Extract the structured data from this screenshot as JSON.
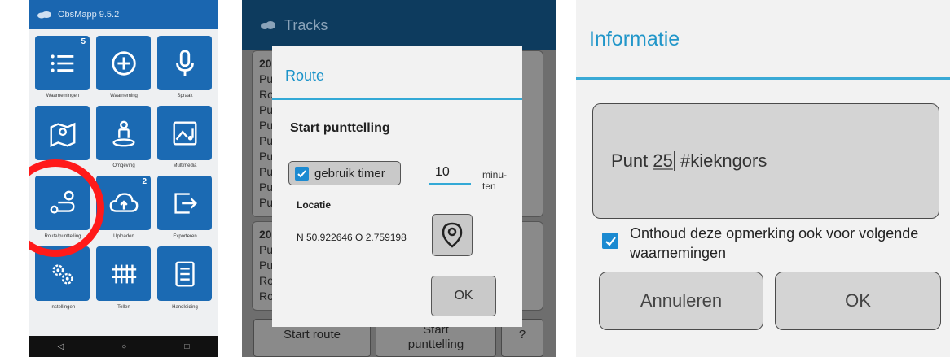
{
  "panel_home": {
    "app_title": "ObsMapp 9.5.2",
    "tiles": [
      {
        "label": "Waarnemingen",
        "icon": "list-icon",
        "badge": "5"
      },
      {
        "label": "Waarneming",
        "icon": "plus-circle-icon",
        "badge": ""
      },
      {
        "label": "Spraak",
        "icon": "microphone-icon",
        "badge": ""
      },
      {
        "label": "Kaart",
        "icon": "map-icon",
        "badge": ""
      },
      {
        "label": "Omgeving",
        "icon": "person-location-icon",
        "badge": ""
      },
      {
        "label": "Multimedia",
        "icon": "multimedia-icon",
        "badge": ""
      },
      {
        "label": "Route/punttelling",
        "icon": "route-icon",
        "badge": ""
      },
      {
        "label": "Uploaden",
        "icon": "cloud-upload-icon",
        "badge": "2"
      },
      {
        "label": "Exporteren",
        "icon": "export-icon",
        "badge": ""
      },
      {
        "label": "Instellingen",
        "icon": "gears-icon",
        "badge": ""
      },
      {
        "label": "Tellen",
        "icon": "tally-icon",
        "badge": ""
      },
      {
        "label": "Handleiding",
        "icon": "manual-icon",
        "badge": ""
      }
    ],
    "nav": {
      "back": "◁",
      "home": "○",
      "recents": "□"
    },
    "highlight_color": "#ff1a1a"
  },
  "panel_route": {
    "app_title": "Tracks",
    "card_prefix_1": "20",
    "card_lines_1": [
      "Pu",
      "Ro",
      "Pu",
      "Pu",
      "Pu",
      "Pu",
      "Pu",
      "Pu",
      "Pu",
      "Pu"
    ],
    "card_prefix_2": "20",
    "card_lines_2": [
      "Pu",
      "Pu",
      "Ro",
      "Ro"
    ],
    "bottom_buttons": {
      "start_route": "Start route",
      "start_count_line1": "Start",
      "start_count_line2": "punttelling",
      "help": "?"
    },
    "dialog": {
      "title": "Route",
      "subtitle": "Start punttelling",
      "timer_label": "gebruik timer",
      "timer_checked": true,
      "minutes_value": "10",
      "minutes_unit": "minu-ten",
      "location_label": "Locatie",
      "coordinates": "N 50.922646 O 2.759198",
      "ok_label": "OK"
    }
  },
  "panel_info": {
    "title": "Informatie",
    "note_prefix": "Punt ",
    "note_number": "25",
    "note_suffix": " #kiekngors",
    "remember_checked": true,
    "remember_label": "Onthoud deze opmerking ook voor volgende waarnemingen",
    "cancel_label": "Annuleren",
    "ok_label": "OK"
  }
}
